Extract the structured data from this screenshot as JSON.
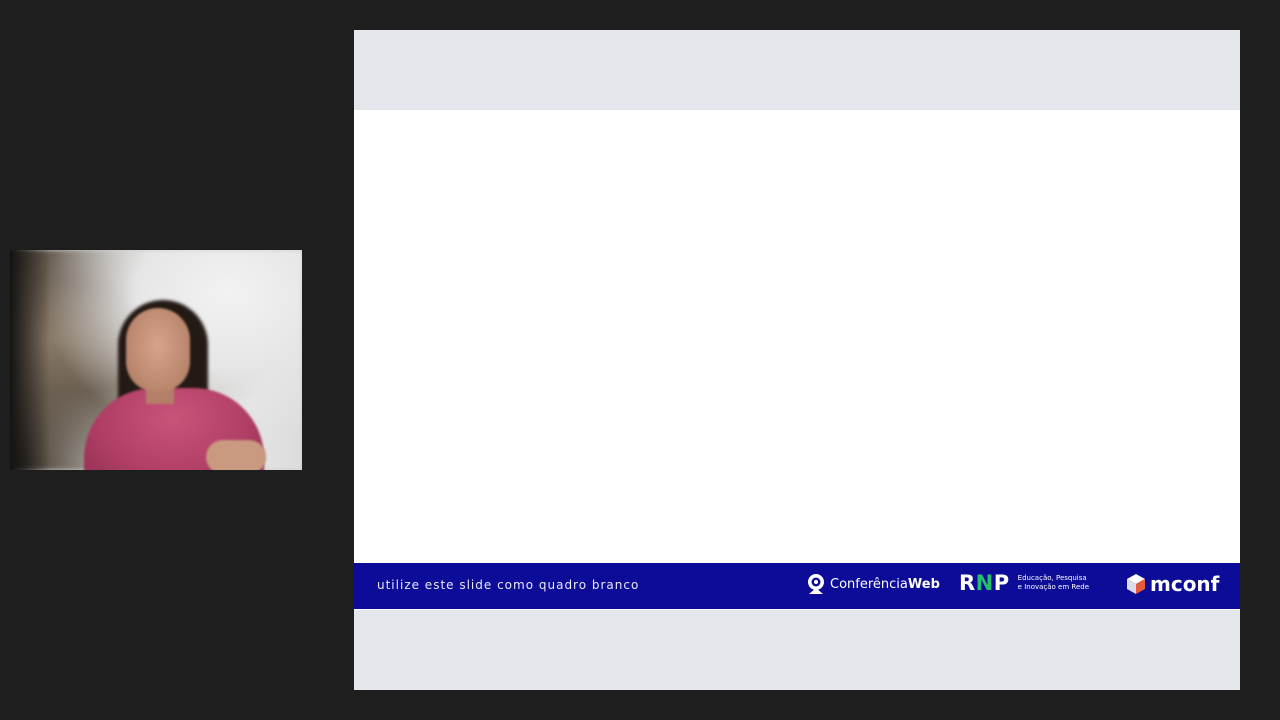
{
  "slide": {
    "footer_caption": "utilize este slide como quadro branco",
    "logos": {
      "conferencia_web": {
        "prefix": "Conferência",
        "suffix": "Web",
        "icon": "webcam-icon"
      },
      "rnp": {
        "mark_r": "R",
        "mark_n": "N",
        "mark_p": "P",
        "tagline_line1": "Educação, Pesquisa",
        "tagline_line2": "e Inovação em Rede"
      },
      "mconf": {
        "text": "mconf",
        "icon": "cube-icon"
      }
    },
    "colors": {
      "footer_bar": "#0c0c98",
      "rnp_accent": "#27c06a",
      "band": "#e3e6ea",
      "background": "#1e1e1e"
    }
  },
  "webcam": {
    "participant": "webcam-feed"
  }
}
